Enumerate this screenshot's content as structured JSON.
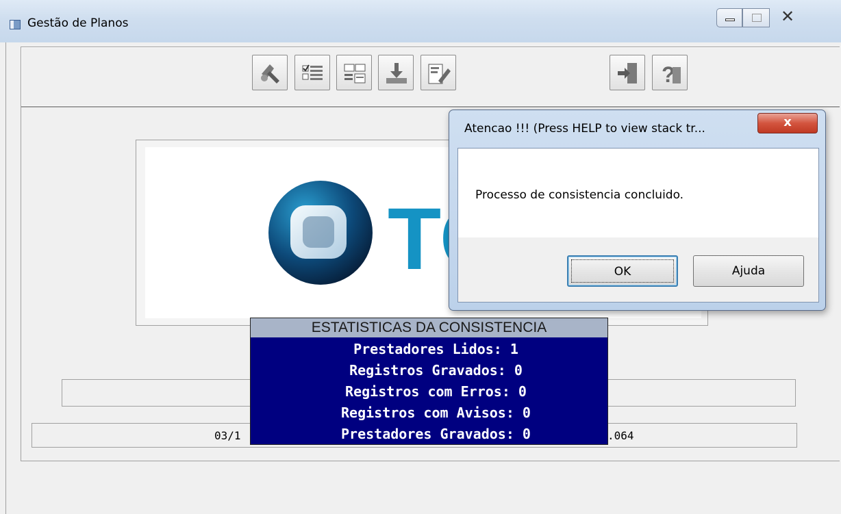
{
  "window": {
    "title": "Gestão de Planos",
    "controls": {
      "minimize": "",
      "maximize": "",
      "close": "✕"
    }
  },
  "toolbar": {
    "buttons": [
      {
        "icon": "tools-icon"
      },
      {
        "icon": "checklist-icon"
      },
      {
        "icon": "table-icon"
      },
      {
        "icon": "download-icon"
      },
      {
        "icon": "edit-icon"
      },
      {
        "icon": "exit-icon"
      },
      {
        "icon": "help-icon"
      }
    ]
  },
  "logo": {
    "text": "TO",
    "accent_color": "#1593c4"
  },
  "status_fields": {
    "line2_left": "03/1",
    "line2_right": ".064"
  },
  "stats": {
    "header": "ESTATISTICAS DA CONSISTENCIA",
    "lines": [
      "Prestadores Lidos: 1",
      "Registros Gravados: 0",
      "Registros com Erros: 0",
      "Registros com Avisos: 0",
      "Prestadores Gravados: 0"
    ],
    "background": "#000080"
  },
  "dialog": {
    "title": "Atencao !!!  (Press HELP to view stack tr...",
    "close_label": "x",
    "message": "Processo de consistencia concluido.",
    "ok_label": "OK",
    "help_label": "Ajuda"
  }
}
